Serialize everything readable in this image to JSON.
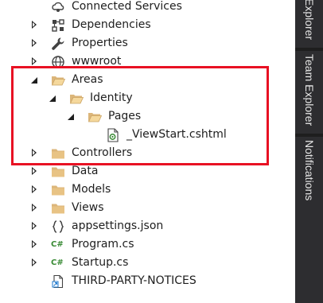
{
  "tree": {
    "items": [
      {
        "label": "Connected Services"
      },
      {
        "label": "Dependencies"
      },
      {
        "label": "Properties"
      },
      {
        "label": "wwwroot"
      },
      {
        "label": "Areas"
      },
      {
        "label": "Identity"
      },
      {
        "label": "Pages"
      },
      {
        "label": "_ViewStart.cshtml"
      },
      {
        "label": "Controllers"
      },
      {
        "label": "Data"
      },
      {
        "label": "Models"
      },
      {
        "label": "Views"
      },
      {
        "label": "appsettings.json"
      },
      {
        "label": "Program.cs"
      },
      {
        "label": "Startup.cs"
      },
      {
        "label": "THIRD-PARTY-NOTICES"
      }
    ]
  },
  "sidebar": {
    "tabs": [
      {
        "label": "Explorer"
      },
      {
        "label": "Team Explorer"
      },
      {
        "label": "Notifications"
      }
    ]
  },
  "icons": {
    "csharp_glyph": "C#",
    "csharp_color": "#388a34",
    "folder_color": "#dcb67a"
  },
  "colors": {
    "highlight_border": "#e81123",
    "sidebar_bg": "#2d2d30"
  }
}
